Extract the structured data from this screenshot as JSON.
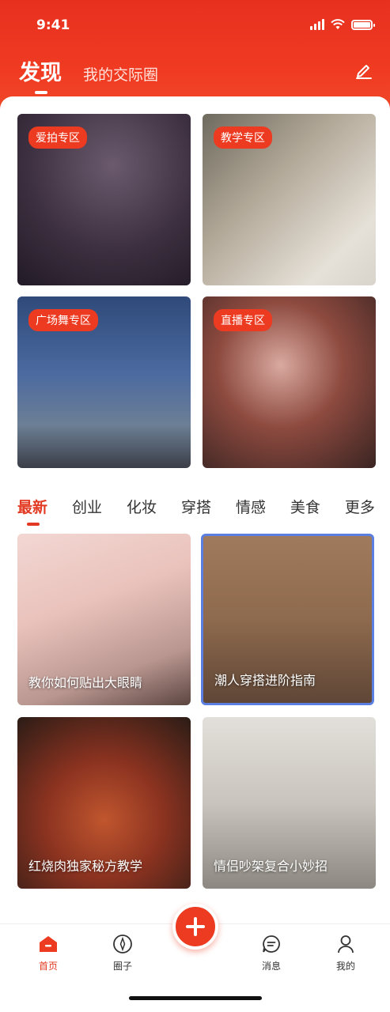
{
  "status_bar": {
    "time": "9:41"
  },
  "header": {
    "tabs": [
      {
        "label": "发现",
        "active": true
      },
      {
        "label": "我的交际圈",
        "active": false
      }
    ],
    "edit_icon": "edit-icon"
  },
  "zones": [
    {
      "badge": "爱拍专区"
    },
    {
      "badge": "教学专区"
    },
    {
      "badge": "广场舞专区"
    },
    {
      "badge": "直播专区"
    }
  ],
  "categories": [
    "最新",
    "创业",
    "化妆",
    "穿搭",
    "情感",
    "美食",
    "更多"
  ],
  "active_category": "最新",
  "posts": [
    {
      "caption": "教你如何贴出大眼睛"
    },
    {
      "caption": "潮人穿搭进阶指南"
    },
    {
      "caption": "红烧肉独家秘方教学"
    },
    {
      "caption": "情侣吵架复合小妙招"
    }
  ],
  "tabbar": {
    "items": [
      {
        "label": "首页",
        "icon": "home-icon",
        "active": true
      },
      {
        "label": "圈子",
        "icon": "compass-icon",
        "active": false
      },
      {
        "label": "",
        "icon": "plus-icon",
        "active": false
      },
      {
        "label": "消息",
        "icon": "message-icon",
        "active": false
      },
      {
        "label": "我的",
        "icon": "user-icon",
        "active": false
      }
    ]
  },
  "colors": {
    "accent": "#ec3b21",
    "active_tab": "#e23a22"
  }
}
